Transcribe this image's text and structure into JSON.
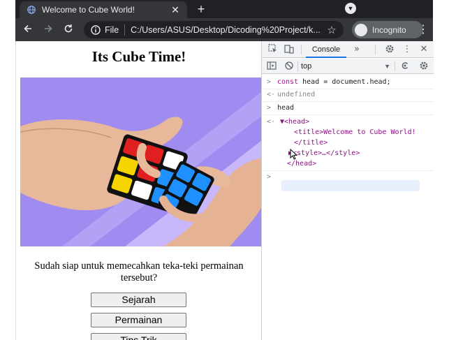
{
  "browser": {
    "tab_title": "Welcome to Cube World!",
    "tab_close": "✕",
    "new_tab": "+",
    "back_icon": "arrow-left",
    "forward_icon": "arrow-right",
    "reload_icon": "reload",
    "scheme_label": "File",
    "url": "C:/Users/ASUS/Desktop/Dicoding%20Project/k...",
    "incognito_label": "Incognito"
  },
  "page": {
    "heading": "Its Cube Time!",
    "paragraph": "Sudah siap untuk memecahkan teka-teki permainan tersebut?",
    "buttons": [
      {
        "label": "Sejarah"
      },
      {
        "label": "Permainan"
      },
      {
        "label": "Tips Trik"
      }
    ],
    "hero_colors": {
      "bg": "#a08cf0",
      "stripe": "#c8b8fb"
    }
  },
  "devtools": {
    "tab_console": "Console",
    "more_tabs": "»",
    "context": "top",
    "lines": [
      {
        "prompt": ">",
        "kind": "input",
        "code_kw": "const",
        "code_rest": " head = document.head;"
      },
      {
        "prompt": "<·",
        "kind": "result",
        "value": "undefined"
      },
      {
        "prompt": ">",
        "kind": "input",
        "code_plain": "head"
      },
      {
        "prompt": "<·",
        "kind": "result",
        "value": "▼<head>"
      },
      {
        "kind": "child",
        "value": "<title>Welcome to Cube World!"
      },
      {
        "kind": "child",
        "value": "</title>"
      },
      {
        "kind": "child",
        "value": "▶<style>…</style>"
      },
      {
        "kind": "close",
        "value": "</head>"
      }
    ],
    "next_prompt": ">"
  },
  "colors": {
    "chrome_dark": "#202124",
    "chrome_mid": "#35363a",
    "devtools_bg": "#f1f3f4",
    "tag_color": "#881280",
    "keyword_color": "#aa0d91",
    "selection": "#e8f0fe"
  }
}
